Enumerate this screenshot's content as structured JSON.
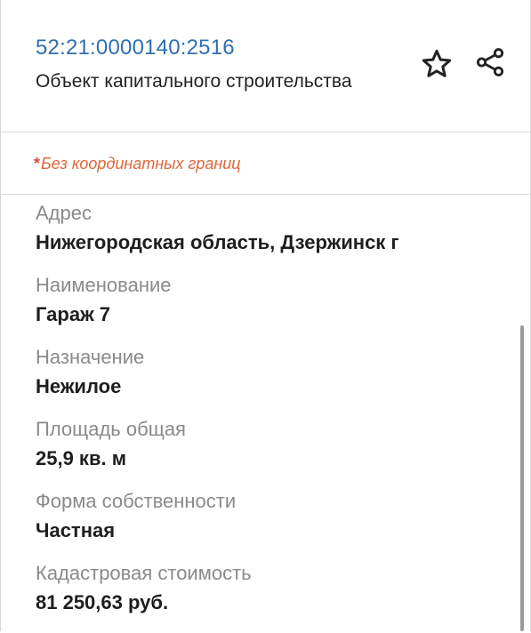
{
  "header": {
    "cadastral_number": "52:21:0000140:2516",
    "object_type": "Объект капитального строительства"
  },
  "notice": {
    "asterisk": "*",
    "text": "Без координатных границ"
  },
  "fields": [
    {
      "label": "Адрес",
      "value": "Нижегородская область, Дзержинск г"
    },
    {
      "label": "Наименование",
      "value": "Гараж 7"
    },
    {
      "label": "Назначение",
      "value": "Нежилое"
    },
    {
      "label": "Площадь общая",
      "value": "25,9 кв. м"
    },
    {
      "label": "Форма собственности",
      "value": "Частная"
    },
    {
      "label": "Кадастровая стоимость",
      "value": "81 250,63 руб."
    }
  ],
  "icons": {
    "favorite": "star-icon",
    "share": "share-icon"
  },
  "colors": {
    "link": "#2f6fb3",
    "notice": "#e0663a",
    "label": "#8a8a8a"
  }
}
